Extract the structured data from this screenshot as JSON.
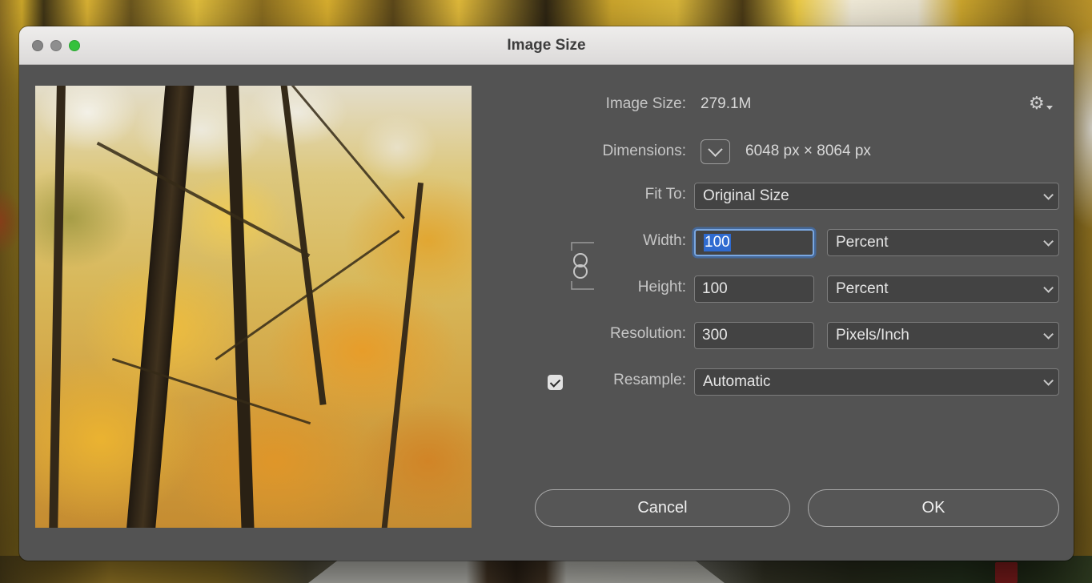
{
  "window": {
    "title": "Image Size"
  },
  "panel": {
    "image_size": {
      "label": "Image Size:",
      "value": "279.1M"
    },
    "dimensions": {
      "label": "Dimensions:",
      "value": "6048 px  ×  8064 px"
    },
    "fit_to": {
      "label": "Fit To:",
      "value": "Original Size"
    },
    "width": {
      "label": "Width:",
      "value": "100",
      "unit": "Percent"
    },
    "height": {
      "label": "Height:",
      "value": "100",
      "unit": "Percent"
    },
    "resolution": {
      "label": "Resolution:",
      "value": "300",
      "unit": "Pixels/Inch"
    },
    "resample": {
      "label": "Resample:",
      "checked": true,
      "value": "Automatic"
    },
    "buttons": {
      "cancel": "Cancel",
      "ok": "OK"
    }
  },
  "icons": {
    "gear": "⚙"
  },
  "colors": {
    "selection_blue": "#2f6bd0",
    "focus_ring": "#7aa7e0",
    "traffic_green": "#34c13c",
    "dialog_bg": "#535353",
    "titlebar_text": "#3d3d3d"
  }
}
